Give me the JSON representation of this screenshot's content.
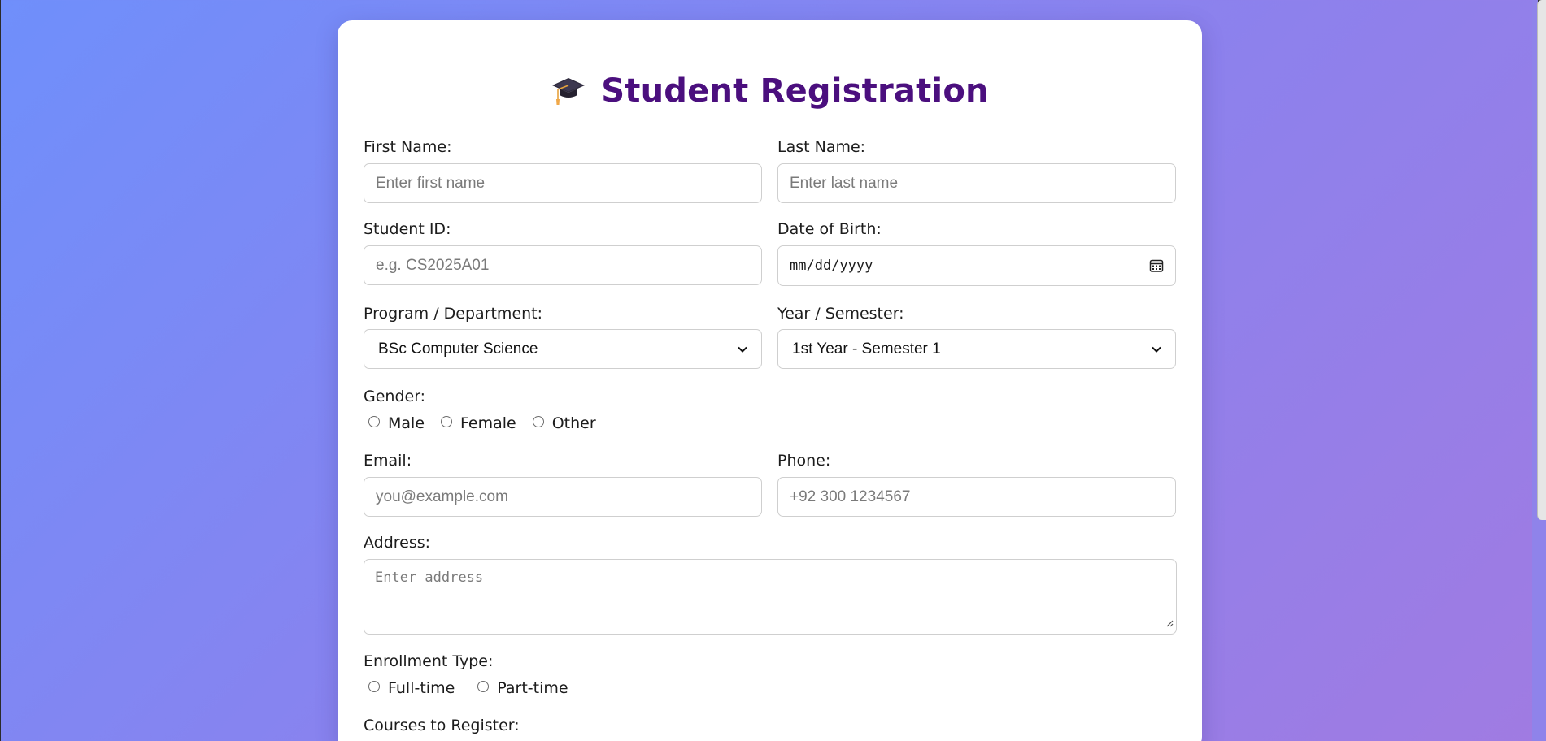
{
  "form": {
    "title": "Student Registration",
    "title_icon": "graduation-cap-icon",
    "first_name": {
      "label": "First Name:",
      "placeholder": "Enter first name"
    },
    "last_name": {
      "label": "Last Name:",
      "placeholder": "Enter last name"
    },
    "student_id": {
      "label": "Student ID:",
      "placeholder": "e.g. CS2025A01"
    },
    "dob": {
      "label": "Date of Birth:",
      "placeholder": "mm/dd/yyyy",
      "icon": "calendar-icon"
    },
    "program": {
      "label": "Program / Department:",
      "selected": "BSc Computer Science"
    },
    "year": {
      "label": "Year / Semester:",
      "selected": "1st Year - Semester 1"
    },
    "gender": {
      "label": "Gender:",
      "options": [
        "Male",
        "Female",
        "Other"
      ]
    },
    "email": {
      "label": "Email:",
      "placeholder": "you@example.com"
    },
    "phone": {
      "label": "Phone:",
      "placeholder": "+92 300 1234567"
    },
    "address": {
      "label": "Address:",
      "placeholder": "Enter address"
    },
    "enrollment": {
      "label": "Enrollment Type:",
      "options": [
        "Full-time",
        "Part-time"
      ]
    },
    "courses": {
      "label": "Courses to Register:"
    }
  },
  "colors": {
    "title": "#4b0f7e",
    "background_start": "#6f8ffb",
    "background_end": "#a07be2"
  }
}
